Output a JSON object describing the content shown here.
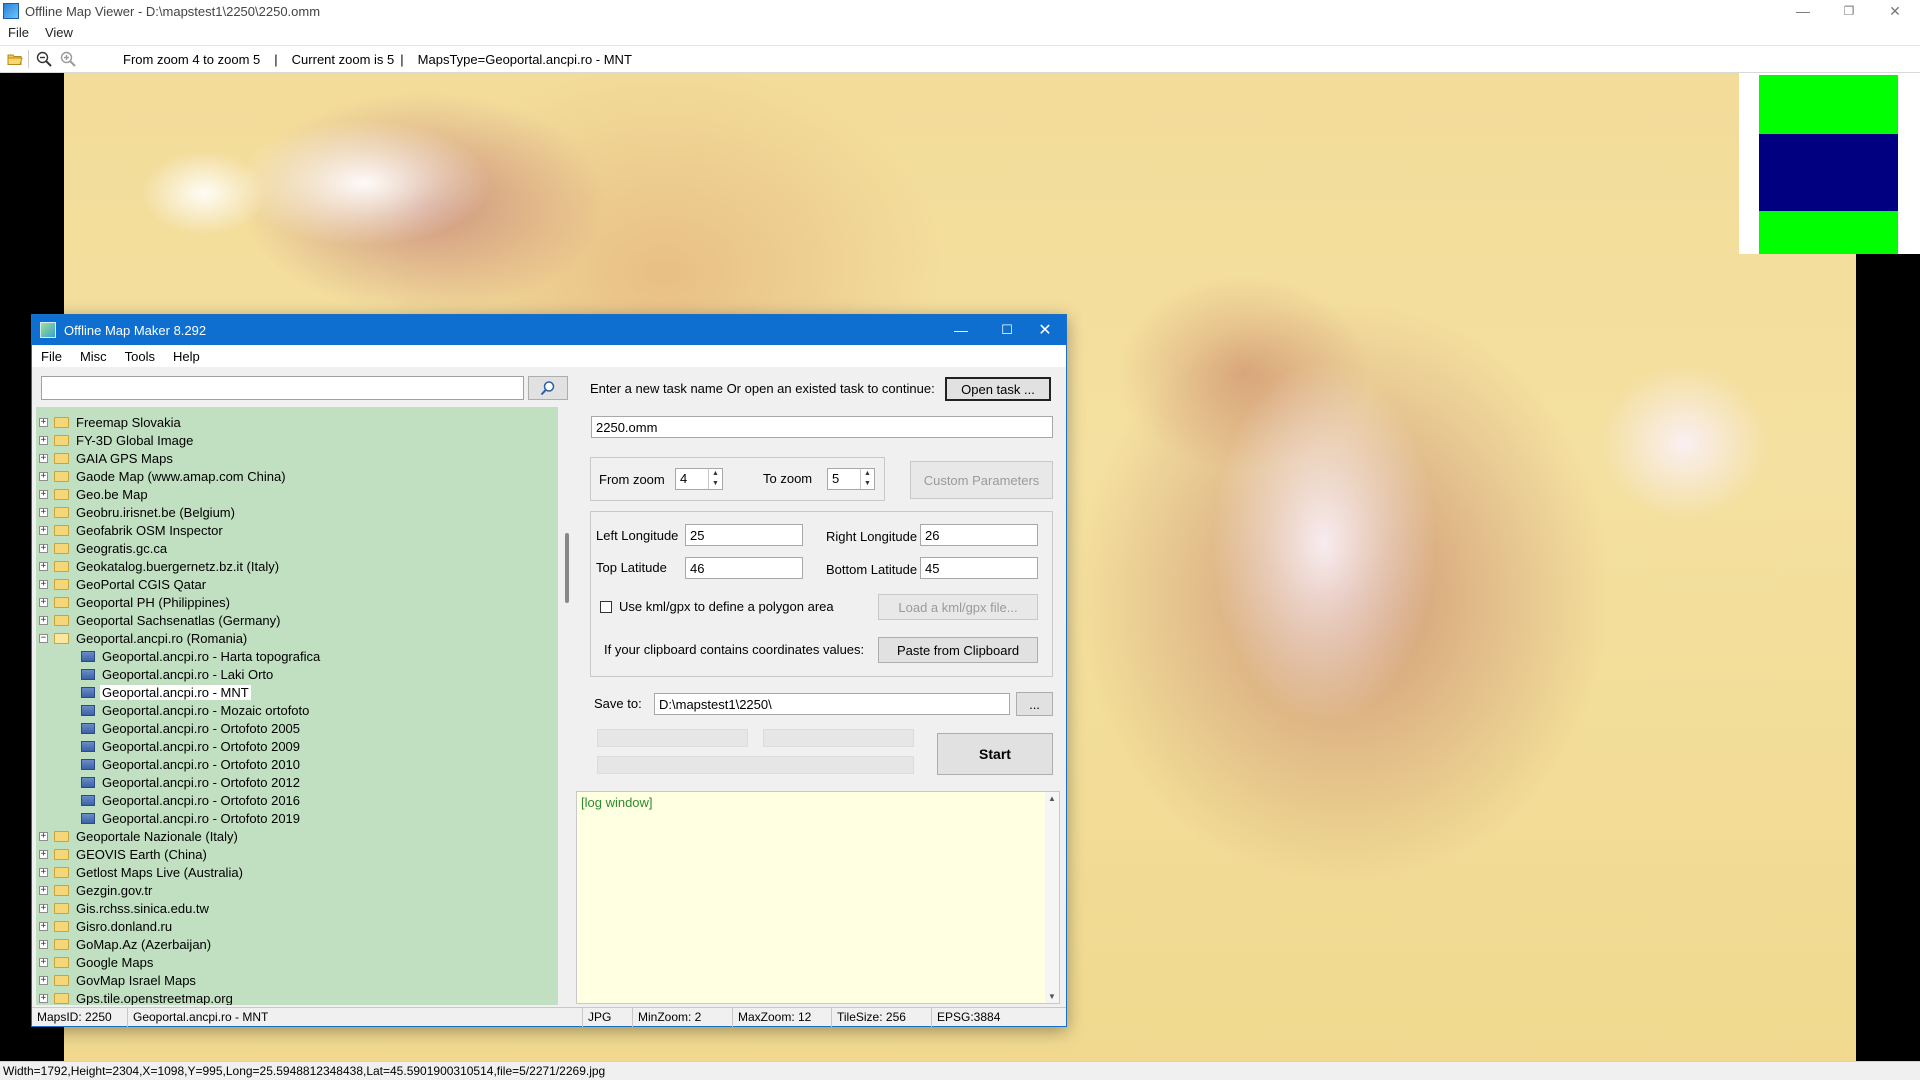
{
  "window": {
    "title": "Offline Map Viewer - D:\\mapstest1\\2250\\2250.omm",
    "menu": [
      "File",
      "View"
    ],
    "controls": {
      "minimize": "—",
      "restore": "❐",
      "close": "✕"
    }
  },
  "toolbar": {
    "zoom_range": "From zoom 4 to zoom 5",
    "current_zoom": "Current zoom is 5",
    "maps_type": "MapsType=Geoportal.ancpi.ro - MNT",
    "separator": "|"
  },
  "statusbar": {
    "text": "Width=1792,Height=2304,X=1098,Y=995,Long=25.5948812348438,Lat=45.5901900310514,file=5/2271/2269.jpg"
  },
  "dialog": {
    "title": "Offline Map Maker 8.292",
    "menu": [
      "File",
      "Misc",
      "Tools",
      "Help"
    ],
    "controls": {
      "minimize": "—",
      "maximize": "☐",
      "close": "✕"
    },
    "search": {
      "value": "",
      "placeholder": ""
    },
    "tree": [
      {
        "label": "Freemap Slovakia",
        "type": "folder",
        "expander": "+"
      },
      {
        "label": "FY-3D Global Image",
        "type": "folder",
        "expander": "+"
      },
      {
        "label": "GAIA GPS Maps",
        "type": "folder",
        "expander": "+"
      },
      {
        "label": "Gaode Map (www.amap.com China)",
        "type": "folder",
        "expander": "+"
      },
      {
        "label": "Geo.be Map",
        "type": "folder",
        "expander": "+"
      },
      {
        "label": "Geobru.irisnet.be (Belgium)",
        "type": "folder",
        "expander": "+"
      },
      {
        "label": "Geofabrik OSM Inspector",
        "type": "folder",
        "expander": "+"
      },
      {
        "label": "Geogratis.gc.ca",
        "type": "folder",
        "expander": "+"
      },
      {
        "label": "Geokatalog.buergernetz.bz.it (Italy)",
        "type": "folder",
        "expander": "+"
      },
      {
        "label": "GeoPortal CGIS Qatar",
        "type": "folder",
        "expander": "+"
      },
      {
        "label": "Geoportal PH (Philippines)",
        "type": "folder",
        "expander": "+"
      },
      {
        "label": "Geoportal Sachsenatlas (Germany)",
        "type": "folder",
        "expander": "+"
      },
      {
        "label": "Geoportal.ancpi.ro (Romania)",
        "type": "folder-open",
        "expander": "−"
      },
      {
        "label": "Geoportal.ancpi.ro - Harta topografica",
        "type": "map"
      },
      {
        "label": "Geoportal.ancpi.ro - Laki Orto",
        "type": "map"
      },
      {
        "label": "Geoportal.ancpi.ro - MNT",
        "type": "map",
        "selected": true
      },
      {
        "label": "Geoportal.ancpi.ro - Mozaic ortofoto",
        "type": "map"
      },
      {
        "label": "Geoportal.ancpi.ro - Ortofoto 2005",
        "type": "map"
      },
      {
        "label": "Geoportal.ancpi.ro - Ortofoto 2009",
        "type": "map"
      },
      {
        "label": "Geoportal.ancpi.ro - Ortofoto 2010",
        "type": "map"
      },
      {
        "label": "Geoportal.ancpi.ro - Ortofoto 2012",
        "type": "map"
      },
      {
        "label": "Geoportal.ancpi.ro - Ortofoto 2016",
        "type": "map"
      },
      {
        "label": "Geoportal.ancpi.ro - Ortofoto 2019",
        "type": "map"
      },
      {
        "label": "Geoportale Nazionale (Italy)",
        "type": "folder",
        "expander": "+"
      },
      {
        "label": "GEOVIS Earth (China)",
        "type": "folder",
        "expander": "+"
      },
      {
        "label": "Getlost Maps Live (Australia)",
        "type": "folder",
        "expander": "+"
      },
      {
        "label": "Gezgin.gov.tr",
        "type": "folder",
        "expander": "+"
      },
      {
        "label": "Gis.rchss.sinica.edu.tw",
        "type": "folder",
        "expander": "+"
      },
      {
        "label": "Gisro.donland.ru",
        "type": "folder",
        "expander": "+"
      },
      {
        "label": "GoMap.Az (Azerbaijan)",
        "type": "folder",
        "expander": "+"
      },
      {
        "label": "Google Maps",
        "type": "folder",
        "expander": "+"
      },
      {
        "label": "GovMap Israel Maps",
        "type": "folder",
        "expander": "+"
      },
      {
        "label": "Gps.tile.openstreetmap.org",
        "type": "folder",
        "expander": "+"
      }
    ],
    "task": {
      "prompt": "Enter a new task name Or open an existed task to continue:",
      "open_button": "Open task ...",
      "name_value": "2250.omm"
    },
    "zoom": {
      "from_label": "From zoom",
      "from_value": "4",
      "to_label": "To zoom",
      "to_value": "5",
      "custom_button": "Custom Parameters"
    },
    "coords": {
      "left_lon_label": "Left Longitude",
      "left_lon_value": "25",
      "right_lon_label": "Right Longitude",
      "right_lon_value": "26",
      "top_lat_label": "Top Latitude",
      "top_lat_value": "46",
      "bottom_lat_label": "Bottom Latitude",
      "bottom_lat_value": "45",
      "kml_checkbox_label": "Use kml/gpx to define a polygon area",
      "kml_checked": false,
      "load_kml_button": "Load a kml/gpx file...",
      "clipboard_label": "If your clipboard contains coordinates values:",
      "paste_button": "Paste from Clipboard"
    },
    "save": {
      "label": "Save to:",
      "value": "D:\\mapstest1\\2250\\",
      "browse_button": "...",
      "start_button": "Start"
    },
    "log": {
      "text": "[log window]"
    },
    "status": {
      "maps_id": "MapsID: 2250",
      "map_name": "Geoportal.ancpi.ro - MNT",
      "format": "JPG",
      "min_zoom": "MinZoom: 2",
      "max_zoom": "MaxZoom: 12",
      "tile_size": "TileSize: 256",
      "epsg": "EPSG:3884"
    }
  },
  "colors": {
    "dialog_titlebar": "#0e6fd1",
    "tree_background": "#c1dfc1",
    "log_background": "#ffffe1",
    "log_text": "#2f8a2f",
    "overlay_green": "#00ff00",
    "overlay_navy": "#000080"
  }
}
